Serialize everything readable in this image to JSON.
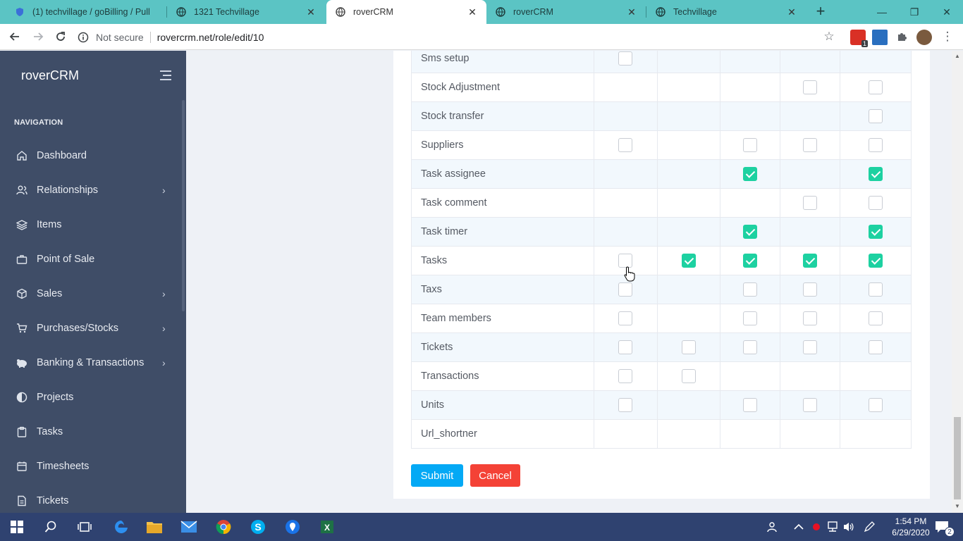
{
  "browser": {
    "tabs": [
      {
        "title": "(1) techvillage / goBilling / Pull",
        "active": false
      },
      {
        "title": "1321 Techvillage",
        "active": false
      },
      {
        "title": "roverCRM",
        "active": true
      },
      {
        "title": "roverCRM",
        "active": false
      },
      {
        "title": "Techvillage",
        "active": false
      }
    ],
    "security_label": "Not secure",
    "url": "rovercrm.net/role/edit/10",
    "extension_badge": "1"
  },
  "sidebar": {
    "brand": "roverCRM",
    "caption": "NAVIGATION",
    "items": [
      {
        "label": "Dashboard",
        "icon": "home-icon",
        "has_children": false
      },
      {
        "label": "Relationships",
        "icon": "users-icon",
        "has_children": true
      },
      {
        "label": "Items",
        "icon": "layers-icon",
        "has_children": false
      },
      {
        "label": "Point of Sale",
        "icon": "briefcase-icon",
        "has_children": false
      },
      {
        "label": "Sales",
        "icon": "box-icon",
        "has_children": true
      },
      {
        "label": "Purchases/Stocks",
        "icon": "cart-icon",
        "has_children": true
      },
      {
        "label": "Banking & Transactions",
        "icon": "piggy-bank-icon",
        "has_children": true
      },
      {
        "label": "Projects",
        "icon": "half-circle-icon",
        "has_children": false
      },
      {
        "label": "Tasks",
        "icon": "clipboard-icon",
        "has_children": false
      },
      {
        "label": "Timesheets",
        "icon": "calendar-icon",
        "has_children": false
      },
      {
        "label": "Tickets",
        "icon": "file-icon",
        "has_children": false
      }
    ]
  },
  "permissions": {
    "rows": [
      {
        "name": "Sms setup",
        "cells": [
          0,
          null,
          null,
          null,
          null
        ]
      },
      {
        "name": "Stock Adjustment",
        "cells": [
          null,
          null,
          null,
          0,
          0
        ]
      },
      {
        "name": "Stock transfer",
        "cells": [
          null,
          null,
          null,
          null,
          0
        ]
      },
      {
        "name": "Suppliers",
        "cells": [
          0,
          null,
          0,
          0,
          0
        ]
      },
      {
        "name": "Task assignee",
        "cells": [
          null,
          null,
          1,
          null,
          1
        ]
      },
      {
        "name": "Task comment",
        "cells": [
          null,
          null,
          null,
          0,
          0
        ]
      },
      {
        "name": "Task timer",
        "cells": [
          null,
          null,
          1,
          null,
          1
        ]
      },
      {
        "name": "Tasks",
        "cells": [
          0,
          1,
          1,
          1,
          1
        ]
      },
      {
        "name": "Taxs",
        "cells": [
          0,
          null,
          0,
          0,
          0
        ]
      },
      {
        "name": "Team members",
        "cells": [
          0,
          null,
          0,
          0,
          0
        ]
      },
      {
        "name": "Tickets",
        "cells": [
          0,
          0,
          0,
          0,
          0
        ]
      },
      {
        "name": "Transactions",
        "cells": [
          0,
          0,
          null,
          null,
          null
        ]
      },
      {
        "name": "Units",
        "cells": [
          0,
          null,
          0,
          0,
          0
        ]
      },
      {
        "name": "Url_shortner",
        "cells": [
          null,
          null,
          null,
          null,
          null
        ]
      }
    ]
  },
  "actions": {
    "submit_label": "Submit",
    "cancel_label": "Cancel"
  },
  "taskbar": {
    "time": "1:54 PM",
    "date": "6/29/2020",
    "notification_count": "2"
  },
  "colors": {
    "sidebar": "#3f4d67",
    "checked": "#1dd1a1",
    "submit": "#04a9f5",
    "cancel": "#f44236",
    "tabstrip": "#5bc4c4",
    "taskbar": "#2f4270"
  }
}
